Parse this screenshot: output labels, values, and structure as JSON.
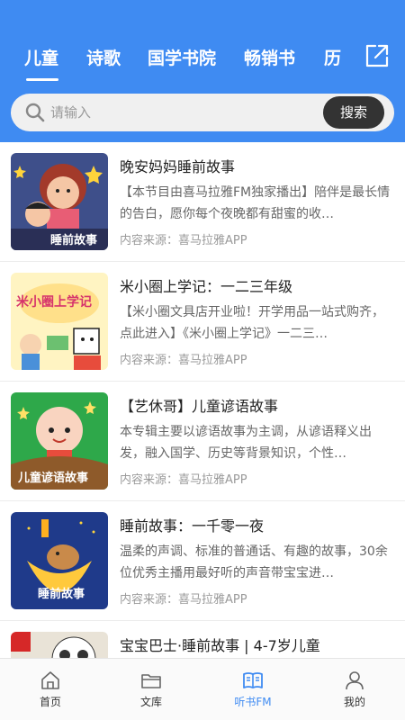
{
  "tabs": [
    "儿童",
    "诗歌",
    "国学书院",
    "畅销书",
    "历"
  ],
  "search": {
    "placeholder": "请输入",
    "button_label": "搜索"
  },
  "items": [
    {
      "title": "晚安妈妈睡前故事",
      "desc": "【本节目由喜马拉雅FM独家播出】陪伴是最长情的告白，愿你每个夜晚都有甜蜜的收…",
      "source": "内容来源：喜马拉雅APP",
      "thumb_text": "睡前故事"
    },
    {
      "title": "米小圈上学记：一二三年级",
      "desc": "【米小圈文具店开业啦！开学用品一站式购齐，点此进入】《米小圈上学记》一二三…",
      "source": "内容来源：喜马拉雅APP",
      "thumb_text": "米小圈上学记"
    },
    {
      "title": "【艺休哥】儿童谚语故事",
      "desc": "本专辑主要以谚语故事为主调，从谚语释义出发，融入国学、历史等背景知识，个性…",
      "source": "内容来源：喜马拉雅APP",
      "thumb_text": "儿童谚语故事"
    },
    {
      "title": "睡前故事：一千零一夜",
      "desc": "温柔的声调、标准的普通话、有趣的故事，30余位优秀主播用最好听的声音带宝宝进…",
      "source": "内容来源：喜马拉雅APP",
      "thumb_text": "睡前故事"
    },
    {
      "title": "宝宝巴士·睡前故事 | 4-7岁儿童",
      "desc": "",
      "source": "",
      "thumb_text": ""
    }
  ],
  "bottom_nav": [
    {
      "label": "首页",
      "icon": "home-icon"
    },
    {
      "label": "文库",
      "icon": "folder-icon"
    },
    {
      "label": "听书FM",
      "icon": "book-icon",
      "active": true
    },
    {
      "label": "我的",
      "icon": "user-icon"
    }
  ],
  "colors": {
    "header": "#3f8bf2",
    "active": "#3f8bf2",
    "search_button": "#333333"
  }
}
